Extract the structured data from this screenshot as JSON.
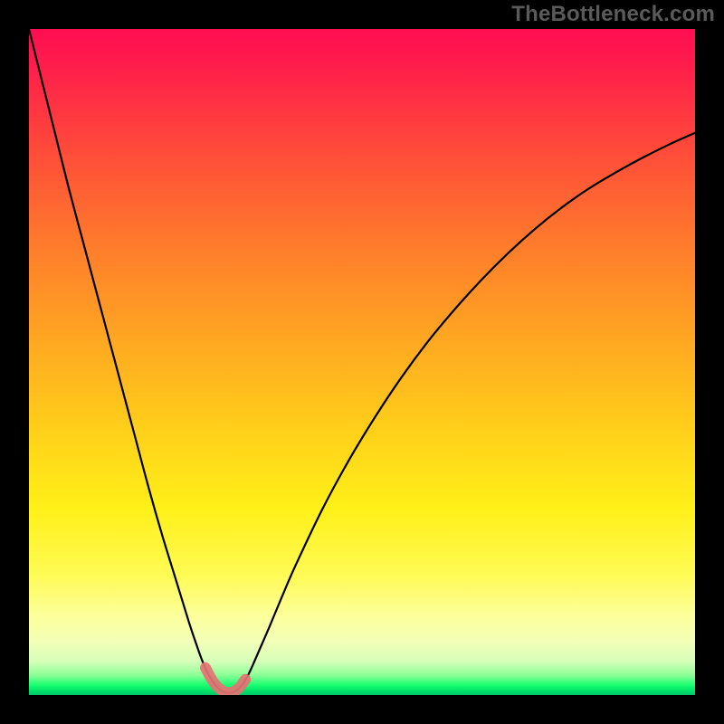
{
  "watermark": "TheBottleneck.com",
  "chart_data": {
    "type": "line",
    "title": "",
    "xlabel": "",
    "ylabel": "",
    "xlim": [
      0,
      100
    ],
    "ylim": [
      0,
      100
    ],
    "grid": false,
    "legend": false,
    "series": [
      {
        "name": "bottleneck-curve",
        "x": [
          0,
          2,
          4,
          6,
          8,
          10,
          12,
          14,
          16,
          18,
          20,
          22,
          24,
          25,
          26,
          27,
          28,
          29,
          30,
          31,
          32,
          33,
          34,
          36,
          38,
          40,
          44,
          48,
          52,
          56,
          60,
          64,
          68,
          72,
          76,
          80,
          84,
          88,
          92,
          96,
          100
        ],
        "y": [
          100,
          92,
          84,
          76,
          68.5,
          61,
          53.5,
          46,
          38.5,
          31,
          24,
          17.5,
          11,
          8,
          5.2,
          3,
          1.5,
          0.6,
          0.3,
          0.6,
          1.5,
          3.2,
          5.4,
          10,
          14.8,
          19.4,
          27.8,
          35.2,
          41.8,
          47.8,
          53.2,
          58,
          62.4,
          66.4,
          70,
          73.2,
          76,
          78.4,
          80.6,
          82.6,
          84.4
        ]
      }
    ],
    "annotations": [
      {
        "name": "optimal-range-marker",
        "x_range": [
          26.5,
          32.5
        ],
        "y_approx": 1.5
      }
    ],
    "background_gradient": {
      "direction": "vertical",
      "stops": [
        {
          "pos": 0.0,
          "color": "#ff0d52"
        },
        {
          "pos": 0.32,
          "color": "#ff7a2c"
        },
        {
          "pos": 0.6,
          "color": "#ffcf1a"
        },
        {
          "pos": 0.88,
          "color": "#fcff9a"
        },
        {
          "pos": 0.97,
          "color": "#8cff96"
        },
        {
          "pos": 1.0,
          "color": "#00c767"
        }
      ]
    }
  }
}
